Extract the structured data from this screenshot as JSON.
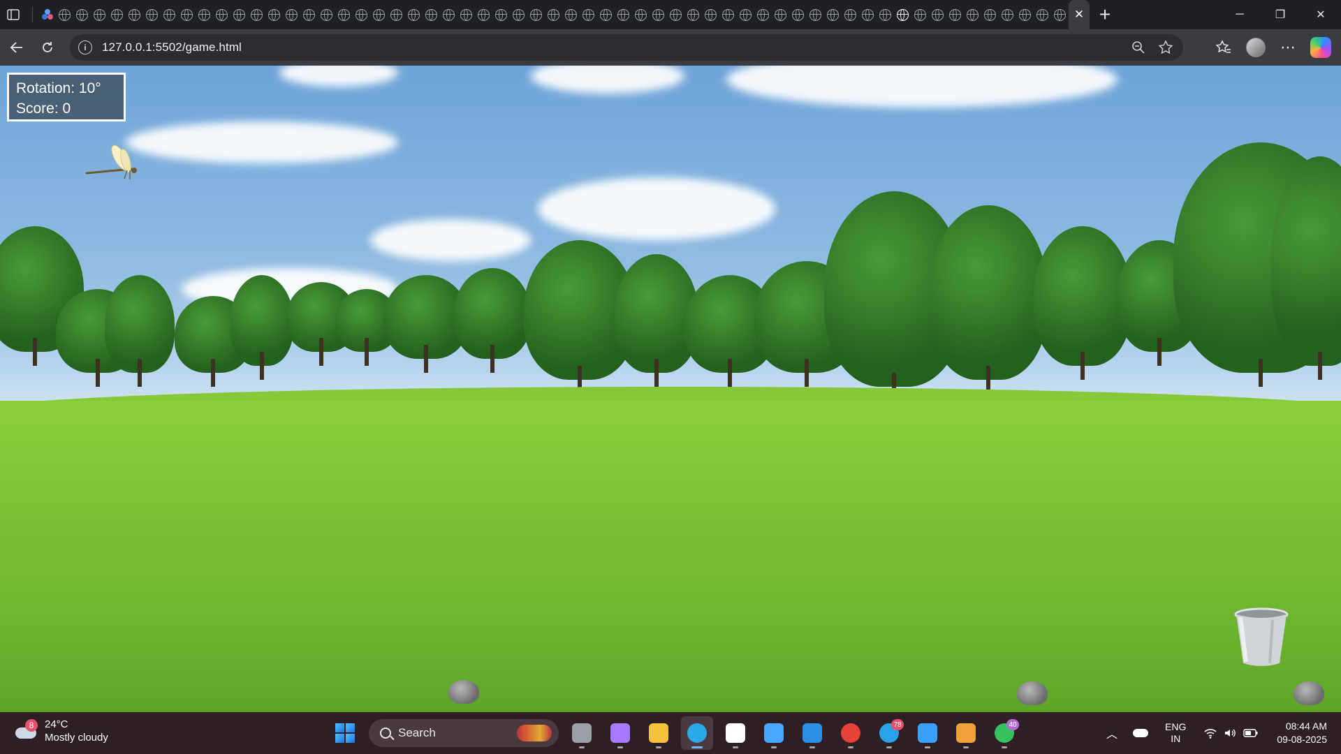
{
  "browser": {
    "url": "127.0.0.1:5502/game.html",
    "tab_count_visible": 58,
    "window_controls": {
      "minimize": "─",
      "restore": "❐",
      "close": "✕"
    },
    "new_tab": "+"
  },
  "game": {
    "hud": {
      "rotation_text": "Rotation: 10°",
      "score_text": "Score: 0"
    },
    "sprites": {
      "dragonfly": "dragonfly",
      "bucket": "bucket",
      "rocks": [
        "rock",
        "rock",
        "rock"
      ]
    }
  },
  "taskbar": {
    "weather": {
      "temp": "24°C",
      "condition": "Mostly cloudy",
      "badge": "8"
    },
    "search_placeholder": "Search",
    "apps": [
      {
        "name": "task-view",
        "color": "#9aa0a6",
        "badge": ""
      },
      {
        "name": "copilot",
        "color": "#a77bff",
        "badge": ""
      },
      {
        "name": "file-explorer",
        "color": "#f2c23a",
        "badge": ""
      },
      {
        "name": "edge",
        "color": "#2aa9e8",
        "badge": "",
        "active": true
      },
      {
        "name": "microsoft-store",
        "color": "#ffffff",
        "badge": ""
      },
      {
        "name": "notepad",
        "color": "#4aa7ff",
        "badge": ""
      },
      {
        "name": "vscode",
        "color": "#2d8fe3",
        "badge": ""
      },
      {
        "name": "chrome",
        "color": "#e84135",
        "badge": ""
      },
      {
        "name": "telegram",
        "color": "#2aa3e6",
        "badge": "78"
      },
      {
        "name": "photos",
        "color": "#3ba1ff",
        "badge": ""
      },
      {
        "name": "git-kraken",
        "color": "#f0a23a",
        "badge": ""
      },
      {
        "name": "whatsapp",
        "color": "#35c160",
        "badge": "40"
      }
    ],
    "tray": {
      "lang_top": "ENG",
      "lang_bottom": "IN",
      "time": "08:44 AM",
      "date": "09-08-2025"
    }
  }
}
